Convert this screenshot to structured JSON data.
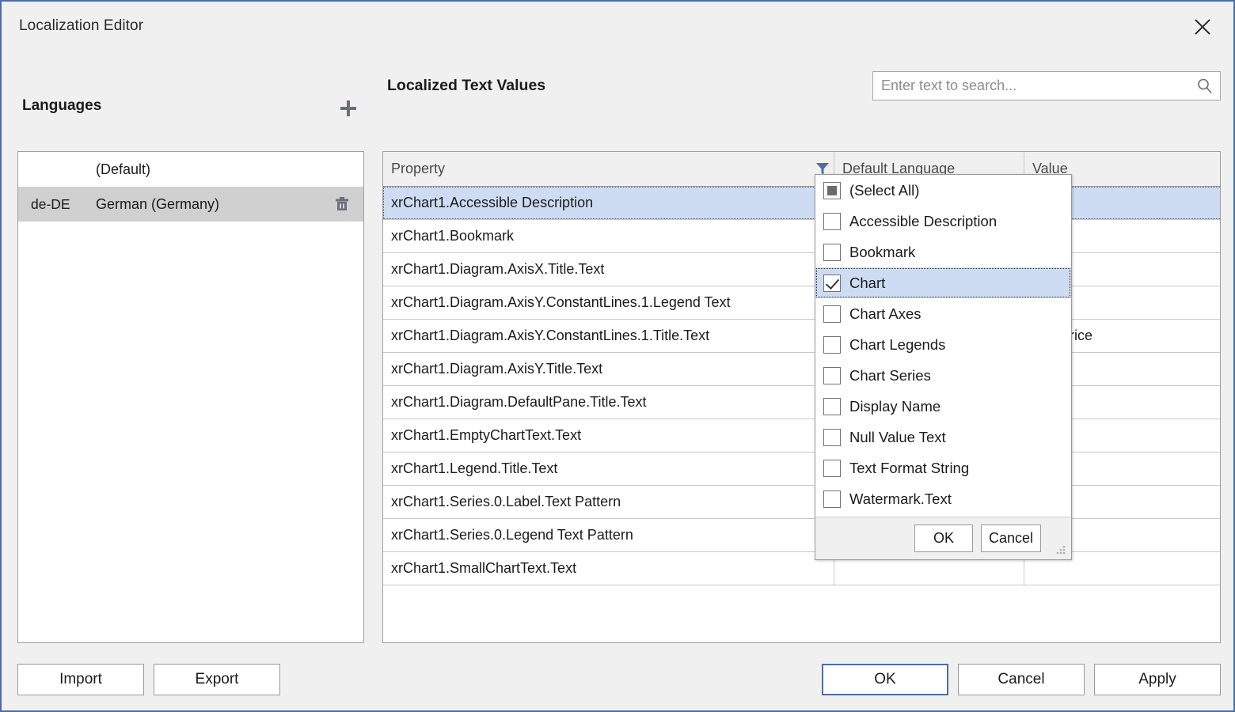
{
  "window": {
    "title": "Localization Editor",
    "close_icon": "close-icon",
    "accent_color": "#4a6ea9"
  },
  "languages_panel": {
    "heading": "Languages",
    "add_icon": "plus-icon",
    "rows": [
      {
        "code": "",
        "name": "(Default)",
        "selected": false,
        "deletable": false
      },
      {
        "code": "de-DE",
        "name": "German (Germany)",
        "selected": true,
        "deletable": true,
        "delete_icon": "trash-icon"
      }
    ]
  },
  "localized_values": {
    "heading": "Localized Text Values",
    "search": {
      "placeholder": "Enter text to search...",
      "value": "",
      "icon": "search-icon"
    },
    "grid": {
      "columns": [
        "Property",
        "Default Language",
        "Value"
      ],
      "filter_icon": "filter-funnel-icon",
      "rows": [
        {
          "property": "xrChart1.Accessible Description",
          "default_language": "",
          "value": "",
          "selected": true
        },
        {
          "property": "xrChart1.Bookmark",
          "default_language": "",
          "value": "",
          "selected": false
        },
        {
          "property": "xrChart1.Diagram.AxisX.Title.Text",
          "default_language": "",
          "value": "",
          "selected": false
        },
        {
          "property": "xrChart1.Diagram.AxisY.ConstantLines.1.Legend Text",
          "default_language": "",
          "value": "",
          "selected": false
        },
        {
          "property": "xrChart1.Diagram.AxisY.ConstantLines.1.Title.Text",
          "default_language": "",
          "value": "age Price",
          "selected": false
        },
        {
          "property": "xrChart1.Diagram.AxisY.Title.Text",
          "default_language": "",
          "value": "",
          "selected": false
        },
        {
          "property": "xrChart1.Diagram.DefaultPane.Title.Text",
          "default_language": "",
          "value": "",
          "selected": false
        },
        {
          "property": "xrChart1.EmptyChartText.Text",
          "default_language": "",
          "value": "",
          "selected": false
        },
        {
          "property": "xrChart1.Legend.Title.Text",
          "default_language": "",
          "value": "",
          "selected": false
        },
        {
          "property": "xrChart1.Series.0.Label.Text Pattern",
          "default_language": "",
          "value": "",
          "selected": false
        },
        {
          "property": "xrChart1.Series.0.Legend Text Pattern",
          "default_language": "",
          "value": "",
          "selected": false
        },
        {
          "property": "xrChart1.SmallChartText.Text",
          "default_language": "",
          "value": "",
          "selected": false
        }
      ]
    }
  },
  "filter_popup": {
    "items": [
      {
        "label": "(Select All)",
        "state": "partial",
        "highlighted": false
      },
      {
        "label": "Accessible Description",
        "state": "unchecked",
        "highlighted": false
      },
      {
        "label": "Bookmark",
        "state": "unchecked",
        "highlighted": false
      },
      {
        "label": "Chart",
        "state": "checked",
        "highlighted": true
      },
      {
        "label": "Chart Axes",
        "state": "unchecked",
        "highlighted": false
      },
      {
        "label": "Chart Legends",
        "state": "unchecked",
        "highlighted": false
      },
      {
        "label": "Chart Series",
        "state": "unchecked",
        "highlighted": false
      },
      {
        "label": "Display Name",
        "state": "unchecked",
        "highlighted": false
      },
      {
        "label": "Null Value Text",
        "state": "unchecked",
        "highlighted": false
      },
      {
        "label": "Text Format String",
        "state": "unchecked",
        "highlighted": false
      },
      {
        "label": "Watermark.Text",
        "state": "unchecked",
        "highlighted": false
      }
    ],
    "ok_label": "OK",
    "cancel_label": "Cancel",
    "resize_grip_icon": "resize-grip-icon"
  },
  "footer": {
    "import_label": "Import",
    "export_label": "Export",
    "ok_label": "OK",
    "cancel_label": "Cancel",
    "apply_label": "Apply"
  }
}
